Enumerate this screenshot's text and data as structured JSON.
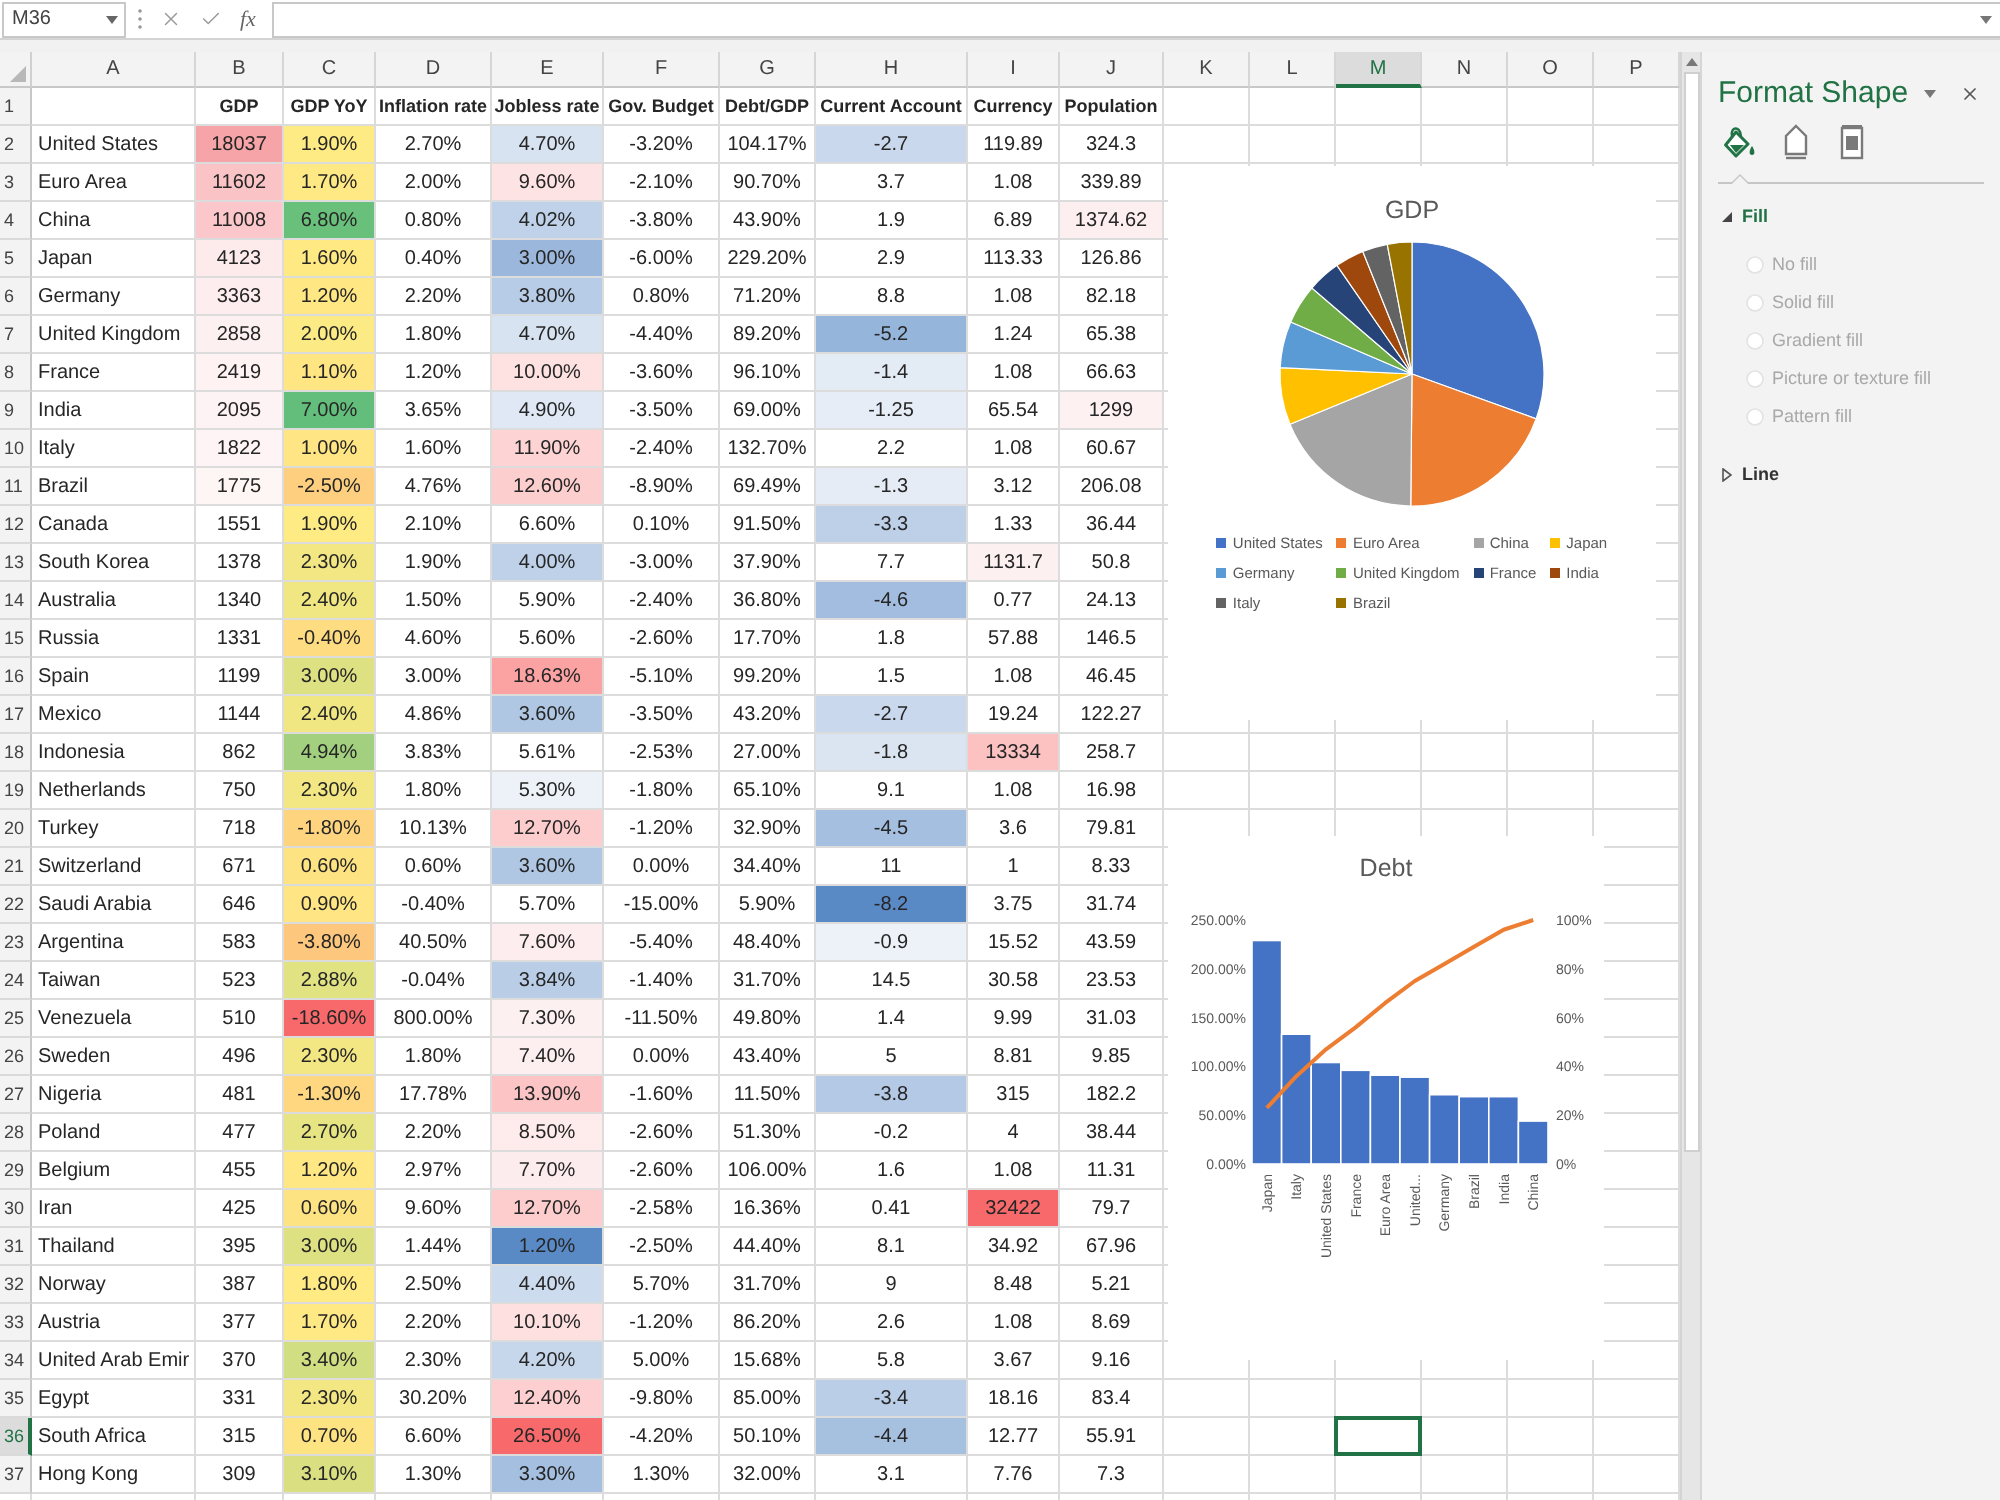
{
  "formula_bar": {
    "name_box": "M36",
    "function_label": "fx"
  },
  "column_headers": [
    {
      "label": "A",
      "selected": false
    },
    {
      "label": "B",
      "selected": false
    },
    {
      "label": "C",
      "selected": false
    },
    {
      "label": "D",
      "selected": false
    },
    {
      "label": "E",
      "selected": false
    },
    {
      "label": "F",
      "selected": false
    },
    {
      "label": "G",
      "selected": false
    },
    {
      "label": "H",
      "selected": false
    },
    {
      "label": "I",
      "selected": false
    },
    {
      "label": "J",
      "selected": false
    },
    {
      "label": "K",
      "selected": false
    },
    {
      "label": "L",
      "selected": false
    },
    {
      "label": "M",
      "selected": true
    },
    {
      "label": "N",
      "selected": false
    },
    {
      "label": "O",
      "selected": false
    },
    {
      "label": "P",
      "selected": false
    }
  ],
  "sheet": {
    "header_row": {
      "number": "1",
      "selected": false,
      "labels": [
        "GDP",
        "GDP YoY",
        "Inflation rate",
        "Jobless rate",
        "Gov. Budget",
        "Debt/GDP",
        "Current Account",
        "Currency",
        "Population"
      ]
    },
    "rows": [
      {
        "number": "2",
        "selected": false,
        "cells": [
          {
            "text": "United States"
          },
          {
            "text": "18037",
            "color": "#f7a4a8"
          },
          {
            "text": "1.90%",
            "color": "#ffeb84"
          },
          {
            "text": "2.70%"
          },
          {
            "text": "4.70%",
            "color": "#d8e3f1"
          },
          {
            "text": "-3.20%"
          },
          {
            "text": "104.17%"
          },
          {
            "text": "-2.7",
            "color": "#c9d8ec"
          },
          {
            "text": "119.89"
          },
          {
            "text": "324.3"
          }
        ]
      },
      {
        "number": "3",
        "selected": false,
        "cells": [
          {
            "text": "Euro Area"
          },
          {
            "text": "11602",
            "color": "#fac4c7"
          },
          {
            "text": "1.70%",
            "color": "#ffe984"
          },
          {
            "text": "2.00%"
          },
          {
            "text": "9.60%",
            "color": "#fee3e4"
          },
          {
            "text": "-2.10%"
          },
          {
            "text": "90.70%"
          },
          {
            "text": "3.7"
          },
          {
            "text": "1.08"
          },
          {
            "text": "339.89"
          }
        ]
      },
      {
        "number": "4",
        "selected": false,
        "cells": [
          {
            "text": "China"
          },
          {
            "text": "11008",
            "color": "#fbc7ca"
          },
          {
            "text": "6.80%",
            "color": "#69c07b"
          },
          {
            "text": "0.80%"
          },
          {
            "text": "4.02%",
            "color": "#bfd2e9"
          },
          {
            "text": "-3.80%"
          },
          {
            "text": "43.90%"
          },
          {
            "text": "1.9"
          },
          {
            "text": "6.89"
          },
          {
            "text": "1374.62",
            "color": "#fdeff0"
          }
        ]
      },
      {
        "number": "5",
        "selected": false,
        "cells": [
          {
            "text": "Japan"
          },
          {
            "text": "4123",
            "color": "#fdeaeb"
          },
          {
            "text": "1.60%",
            "color": "#ffe983"
          },
          {
            "text": "0.40%"
          },
          {
            "text": "3.00%",
            "color": "#9bb8dc"
          },
          {
            "text": "-6.00%"
          },
          {
            "text": "229.20%"
          },
          {
            "text": "2.9"
          },
          {
            "text": "113.33"
          },
          {
            "text": "126.86"
          }
        ]
      },
      {
        "number": "6",
        "selected": false,
        "cells": [
          {
            "text": "Germany"
          },
          {
            "text": "3363",
            "color": "#fdedee"
          },
          {
            "text": "1.20%",
            "color": "#ffe783"
          },
          {
            "text": "2.20%"
          },
          {
            "text": "3.80%",
            "color": "#b7cce6"
          },
          {
            "text": "0.80%"
          },
          {
            "text": "71.20%"
          },
          {
            "text": "8.8"
          },
          {
            "text": "1.08"
          },
          {
            "text": "82.18"
          }
        ]
      },
      {
        "number": "7",
        "selected": false,
        "cells": [
          {
            "text": "United Kingdom"
          },
          {
            "text": "2858",
            "color": "#fdf0f1"
          },
          {
            "text": "2.00%",
            "color": "#fcea84"
          },
          {
            "text": "1.80%"
          },
          {
            "text": "4.70%",
            "color": "#d8e3f1"
          },
          {
            "text": "-4.40%"
          },
          {
            "text": "89.20%"
          },
          {
            "text": "-5.2",
            "color": "#96b5db"
          },
          {
            "text": "1.24"
          },
          {
            "text": "65.38"
          }
        ]
      },
      {
        "number": "8",
        "selected": false,
        "cells": [
          {
            "text": "France"
          },
          {
            "text": "2419",
            "color": "#fef2f3"
          },
          {
            "text": "1.10%",
            "color": "#ffe683"
          },
          {
            "text": "1.20%"
          },
          {
            "text": "10.00%",
            "color": "#fee1e1"
          },
          {
            "text": "-3.60%"
          },
          {
            "text": "96.10%"
          },
          {
            "text": "-1.4",
            "color": "#e3ebf5"
          },
          {
            "text": "1.08"
          },
          {
            "text": "66.63"
          }
        ]
      },
      {
        "number": "9",
        "selected": false,
        "cells": [
          {
            "text": "India"
          },
          {
            "text": "2095",
            "color": "#fef3f4"
          },
          {
            "text": "7.00%",
            "color": "#63be7b"
          },
          {
            "text": "3.65%"
          },
          {
            "text": "4.90%",
            "color": "#dfe8f4"
          },
          {
            "text": "-3.50%"
          },
          {
            "text": "69.00%"
          },
          {
            "text": "-1.25",
            "color": "#e6edf6"
          },
          {
            "text": "65.54"
          },
          {
            "text": "1299",
            "color": "#fdf1f2"
          }
        ]
      },
      {
        "number": "10",
        "selected": false,
        "cells": [
          {
            "text": "Italy"
          },
          {
            "text": "1822",
            "color": "#fef4f5"
          },
          {
            "text": "1.00%",
            "color": "#ffe583"
          },
          {
            "text": "1.60%"
          },
          {
            "text": "11.90%",
            "color": "#fdd3d3"
          },
          {
            "text": "-2.40%"
          },
          {
            "text": "132.70%"
          },
          {
            "text": "2.2"
          },
          {
            "text": "1.08"
          },
          {
            "text": "60.67"
          }
        ]
      },
      {
        "number": "11",
        "selected": false,
        "cells": [
          {
            "text": "Brazil"
          },
          {
            "text": "1775",
            "color": "#fef5f5"
          },
          {
            "text": "-2.50%",
            "color": "#fdcf7f"
          },
          {
            "text": "4.76%"
          },
          {
            "text": "12.60%",
            "color": "#fdcece"
          },
          {
            "text": "-8.90%"
          },
          {
            "text": "69.49%"
          },
          {
            "text": "-1.3",
            "color": "#e5ecf6"
          },
          {
            "text": "3.12"
          },
          {
            "text": "206.08"
          }
        ]
      },
      {
        "number": "12",
        "selected": false,
        "cells": [
          {
            "text": "Canada"
          },
          {
            "text": "1551"
          },
          {
            "text": "1.90%",
            "color": "#ffeb84"
          },
          {
            "text": "2.10%"
          },
          {
            "text": "6.60%"
          },
          {
            "text": "0.10%"
          },
          {
            "text": "91.50%"
          },
          {
            "text": "-3.3",
            "color": "#bdd0e8"
          },
          {
            "text": "1.33"
          },
          {
            "text": "36.44"
          }
        ]
      },
      {
        "number": "13",
        "selected": false,
        "cells": [
          {
            "text": "South Korea"
          },
          {
            "text": "1378"
          },
          {
            "text": "2.30%",
            "color": "#f3e783"
          },
          {
            "text": "1.90%"
          },
          {
            "text": "4.00%",
            "color": "#bed1e9"
          },
          {
            "text": "-3.00%"
          },
          {
            "text": "37.90%"
          },
          {
            "text": "7.7"
          },
          {
            "text": "1131.7",
            "color": "#fdf0f1"
          },
          {
            "text": "50.8"
          }
        ]
      },
      {
        "number": "14",
        "selected": false,
        "cells": [
          {
            "text": "Australia"
          },
          {
            "text": "1340"
          },
          {
            "text": "2.40%",
            "color": "#f0e783"
          },
          {
            "text": "1.50%"
          },
          {
            "text": "5.90%"
          },
          {
            "text": "-2.40%"
          },
          {
            "text": "36.80%"
          },
          {
            "text": "-4.6",
            "color": "#a2bddf"
          },
          {
            "text": "0.77"
          },
          {
            "text": "24.13"
          }
        ]
      },
      {
        "number": "15",
        "selected": false,
        "cells": [
          {
            "text": "Russia"
          },
          {
            "text": "1331"
          },
          {
            "text": "-0.40%",
            "color": "#fedc81"
          },
          {
            "text": "4.60%"
          },
          {
            "text": "5.60%"
          },
          {
            "text": "-2.60%"
          },
          {
            "text": "17.70%"
          },
          {
            "text": "1.8"
          },
          {
            "text": "57.88"
          },
          {
            "text": "146.5"
          }
        ]
      },
      {
        "number": "16",
        "selected": false,
        "cells": [
          {
            "text": "Spain"
          },
          {
            "text": "1199"
          },
          {
            "text": "3.00%",
            "color": "#dde182"
          },
          {
            "text": "3.00%"
          },
          {
            "text": "18.63%",
            "color": "#fba2a3"
          },
          {
            "text": "-5.10%"
          },
          {
            "text": "99.20%"
          },
          {
            "text": "1.5"
          },
          {
            "text": "1.08"
          },
          {
            "text": "46.45"
          }
        ]
      },
      {
        "number": "17",
        "selected": false,
        "cells": [
          {
            "text": "Mexico"
          },
          {
            "text": "1144"
          },
          {
            "text": "2.40%",
            "color": "#f0e783"
          },
          {
            "text": "4.86%"
          },
          {
            "text": "3.60%",
            "color": "#b0c7e4"
          },
          {
            "text": "-3.50%"
          },
          {
            "text": "43.20%"
          },
          {
            "text": "-2.7",
            "color": "#c9d8ec"
          },
          {
            "text": "19.24"
          },
          {
            "text": "122.27"
          }
        ]
      },
      {
        "number": "18",
        "selected": false,
        "cells": [
          {
            "text": "Indonesia"
          },
          {
            "text": "862"
          },
          {
            "text": "4.94%",
            "color": "#a2d07f"
          },
          {
            "text": "3.83%"
          },
          {
            "text": "5.61%"
          },
          {
            "text": "-2.53%"
          },
          {
            "text": "27.00%"
          },
          {
            "text": "-1.8",
            "color": "#dbe5f2"
          },
          {
            "text": "13334",
            "color": "#fcc1c1"
          },
          {
            "text": "258.7"
          }
        ]
      },
      {
        "number": "19",
        "selected": false,
        "cells": [
          {
            "text": "Netherlands"
          },
          {
            "text": "750"
          },
          {
            "text": "2.30%",
            "color": "#f3e783"
          },
          {
            "text": "1.80%"
          },
          {
            "text": "5.30%",
            "color": "#edf2f9"
          },
          {
            "text": "-1.80%"
          },
          {
            "text": "65.10%"
          },
          {
            "text": "9.1"
          },
          {
            "text": "1.08"
          },
          {
            "text": "16.98"
          }
        ]
      },
      {
        "number": "20",
        "selected": false,
        "cells": [
          {
            "text": "Turkey"
          },
          {
            "text": "718"
          },
          {
            "text": "-1.80%",
            "color": "#fed47f"
          },
          {
            "text": "10.13%"
          },
          {
            "text": "12.70%",
            "color": "#fdcdce"
          },
          {
            "text": "-1.20%"
          },
          {
            "text": "32.90%"
          },
          {
            "text": "-4.5",
            "color": "#a4bfe0"
          },
          {
            "text": "3.6"
          },
          {
            "text": "79.81"
          }
        ]
      },
      {
        "number": "21",
        "selected": false,
        "cells": [
          {
            "text": "Switzerland"
          },
          {
            "text": "671"
          },
          {
            "text": "0.60%",
            "color": "#fee383"
          },
          {
            "text": "0.60%"
          },
          {
            "text": "3.60%",
            "color": "#b0c7e4"
          },
          {
            "text": "0.00%"
          },
          {
            "text": "34.40%"
          },
          {
            "text": "11"
          },
          {
            "text": "1"
          },
          {
            "text": "8.33"
          }
        ]
      },
      {
        "number": "22",
        "selected": false,
        "cells": [
          {
            "text": "Saudi Arabia"
          },
          {
            "text": "646"
          },
          {
            "text": "0.90%",
            "color": "#ffe583"
          },
          {
            "text": "-0.40%"
          },
          {
            "text": "5.70%"
          },
          {
            "text": "-15.00%"
          },
          {
            "text": "5.90%"
          },
          {
            "text": "-8.2",
            "color": "#5a8ac6"
          },
          {
            "text": "3.75"
          },
          {
            "text": "31.74"
          }
        ]
      },
      {
        "number": "23",
        "selected": false,
        "cells": [
          {
            "text": "Argentina"
          },
          {
            "text": "583"
          },
          {
            "text": "-3.80%",
            "color": "#fdc77d"
          },
          {
            "text": "40.50%"
          },
          {
            "text": "7.60%",
            "color": "#fdedee"
          },
          {
            "text": "-5.40%"
          },
          {
            "text": "48.40%"
          },
          {
            "text": "-0.9",
            "color": "#edf2f9"
          },
          {
            "text": "15.52"
          },
          {
            "text": "43.59"
          }
        ]
      },
      {
        "number": "24",
        "selected": false,
        "cells": [
          {
            "text": "Taiwan"
          },
          {
            "text": "523"
          },
          {
            "text": "2.88%",
            "color": "#e1e282"
          },
          {
            "text": "-0.04%"
          },
          {
            "text": "3.84%",
            "color": "#b9cde7"
          },
          {
            "text": "-1.40%"
          },
          {
            "text": "31.70%"
          },
          {
            "text": "14.5"
          },
          {
            "text": "30.58"
          },
          {
            "text": "23.53"
          }
        ]
      },
      {
        "number": "25",
        "selected": false,
        "cells": [
          {
            "text": "Venezuela"
          },
          {
            "text": "510"
          },
          {
            "text": "-18.60%",
            "color": "#f8696b"
          },
          {
            "text": "800.00%"
          },
          {
            "text": "7.30%",
            "color": "#fdf0f1"
          },
          {
            "text": "-11.50%"
          },
          {
            "text": "49.80%"
          },
          {
            "text": "1.4"
          },
          {
            "text": "9.99"
          },
          {
            "text": "31.03"
          }
        ]
      },
      {
        "number": "26",
        "selected": false,
        "cells": [
          {
            "text": "Sweden"
          },
          {
            "text": "496"
          },
          {
            "text": "2.30%",
            "color": "#f3e783"
          },
          {
            "text": "1.80%"
          },
          {
            "text": "7.40%",
            "color": "#fdeff0"
          },
          {
            "text": "0.00%"
          },
          {
            "text": "43.40%"
          },
          {
            "text": "5"
          },
          {
            "text": "8.81"
          },
          {
            "text": "9.85"
          }
        ]
      },
      {
        "number": "27",
        "selected": false,
        "cells": [
          {
            "text": "Nigeria"
          },
          {
            "text": "481"
          },
          {
            "text": "-1.30%",
            "color": "#fed780"
          },
          {
            "text": "17.78%"
          },
          {
            "text": "13.90%",
            "color": "#fcc4c5"
          },
          {
            "text": "-1.60%"
          },
          {
            "text": "11.50%"
          },
          {
            "text": "-3.8",
            "color": "#b3c9e5"
          },
          {
            "text": "315"
          },
          {
            "text": "182.2"
          }
        ]
      },
      {
        "number": "28",
        "selected": false,
        "cells": [
          {
            "text": "Poland"
          },
          {
            "text": "477"
          },
          {
            "text": "2.70%",
            "color": "#e7e483"
          },
          {
            "text": "2.20%"
          },
          {
            "text": "8.50%",
            "color": "#feebec"
          },
          {
            "text": "-2.60%"
          },
          {
            "text": "51.30%"
          },
          {
            "text": "-0.2"
          },
          {
            "text": "4"
          },
          {
            "text": "38.44"
          }
        ]
      },
      {
        "number": "29",
        "selected": false,
        "cells": [
          {
            "text": "Belgium"
          },
          {
            "text": "455"
          },
          {
            "text": "1.20%",
            "color": "#ffe783"
          },
          {
            "text": "2.97%"
          },
          {
            "text": "7.70%",
            "color": "#fdecee"
          },
          {
            "text": "-2.60%"
          },
          {
            "text": "106.00%"
          },
          {
            "text": "1.6"
          },
          {
            "text": "1.08"
          },
          {
            "text": "11.31"
          }
        ]
      },
      {
        "number": "30",
        "selected": false,
        "cells": [
          {
            "text": "Iran"
          },
          {
            "text": "425"
          },
          {
            "text": "0.60%",
            "color": "#fee383"
          },
          {
            "text": "9.60%"
          },
          {
            "text": "12.70%",
            "color": "#fdcdce"
          },
          {
            "text": "-2.58%"
          },
          {
            "text": "16.36%"
          },
          {
            "text": "0.41"
          },
          {
            "text": "32422",
            "color": "#f8696b"
          },
          {
            "text": "79.7"
          }
        ]
      },
      {
        "number": "31",
        "selected": false,
        "cells": [
          {
            "text": "Thailand"
          },
          {
            "text": "395"
          },
          {
            "text": "3.00%",
            "color": "#dde182"
          },
          {
            "text": "1.44%"
          },
          {
            "text": "1.20%",
            "color": "#5a8ac6"
          },
          {
            "text": "-2.50%"
          },
          {
            "text": "44.40%"
          },
          {
            "text": "8.1"
          },
          {
            "text": "34.92"
          },
          {
            "text": "67.96"
          }
        ]
      },
      {
        "number": "32",
        "selected": false,
        "cells": [
          {
            "text": "Norway"
          },
          {
            "text": "387"
          },
          {
            "text": "1.80%",
            "color": "#ffea84"
          },
          {
            "text": "2.50%"
          },
          {
            "text": "4.40%",
            "color": "#cddbee"
          },
          {
            "text": "5.70%"
          },
          {
            "text": "31.70%"
          },
          {
            "text": "9"
          },
          {
            "text": "8.48"
          },
          {
            "text": "5.21"
          }
        ]
      },
      {
        "number": "33",
        "selected": false,
        "cells": [
          {
            "text": "Austria"
          },
          {
            "text": "377"
          },
          {
            "text": "1.70%",
            "color": "#ffe984"
          },
          {
            "text": "2.20%"
          },
          {
            "text": "10.10%",
            "color": "#fee0e0"
          },
          {
            "text": "-1.20%"
          },
          {
            "text": "86.20%"
          },
          {
            "text": "2.6"
          },
          {
            "text": "1.08"
          },
          {
            "text": "8.69"
          }
        ]
      },
      {
        "number": "34",
        "selected": false,
        "cells": [
          {
            "text": "United Arab Emir"
          },
          {
            "text": "370"
          },
          {
            "text": "3.40%",
            "color": "#d1de81"
          },
          {
            "text": "2.30%"
          },
          {
            "text": "4.20%",
            "color": "#c6d6eb"
          },
          {
            "text": "5.00%"
          },
          {
            "text": "15.68%"
          },
          {
            "text": "5.8"
          },
          {
            "text": "3.67"
          },
          {
            "text": "9.16"
          }
        ]
      },
      {
        "number": "35",
        "selected": false,
        "cells": [
          {
            "text": "Egypt"
          },
          {
            "text": "331"
          },
          {
            "text": "2.30%",
            "color": "#f3e783"
          },
          {
            "text": "30.20%"
          },
          {
            "text": "12.40%",
            "color": "#fdcfd0"
          },
          {
            "text": "-9.80%"
          },
          {
            "text": "85.00%"
          },
          {
            "text": "-3.4",
            "color": "#bbcee7"
          },
          {
            "text": "18.16"
          },
          {
            "text": "83.4"
          }
        ]
      },
      {
        "number": "36",
        "selected": true,
        "cells": [
          {
            "text": "South Africa"
          },
          {
            "text": "315"
          },
          {
            "text": "0.70%",
            "color": "#fee383"
          },
          {
            "text": "6.60%"
          },
          {
            "text": "26.50%",
            "color": "#f8696b"
          },
          {
            "text": "-4.20%"
          },
          {
            "text": "50.10%"
          },
          {
            "text": "-4.4",
            "color": "#a6c0e0"
          },
          {
            "text": "12.77"
          },
          {
            "text": "55.91"
          }
        ]
      },
      {
        "number": "37",
        "selected": false,
        "cells": [
          {
            "text": "Hong Kong"
          },
          {
            "text": "309"
          },
          {
            "text": "3.10%",
            "color": "#dae082"
          },
          {
            "text": "1.30%"
          },
          {
            "text": "3.30%",
            "color": "#a5bfe0"
          },
          {
            "text": "1.30%"
          },
          {
            "text": "32.00%"
          },
          {
            "text": "3.1"
          },
          {
            "text": "7.76"
          },
          {
            "text": "7.3"
          }
        ]
      }
    ]
  },
  "gdp_chart": {
    "chart_data": [
      {
        "type": "pie",
        "title": "GDP",
        "categories": [
          "United States",
          "Euro Area",
          "China",
          "Japan",
          "Germany",
          "United Kingdom",
          "France",
          "India",
          "Italy",
          "Brazil"
        ],
        "values": [
          30.52,
          19.63,
          18.63,
          6.98,
          5.69,
          4.84,
          4.09,
          3.54,
          3.08,
          3.0
        ],
        "colors": [
          "#4472c4",
          "#ed7d31",
          "#a5a5a5",
          "#ffc000",
          "#5b9bd5",
          "#70ad47",
          "#264478",
          "#9e480e",
          "#636363",
          "#997300"
        ],
        "legend": "bottom"
      }
    ]
  },
  "debt_chart": {
    "chart_data": [
      {
        "type": "bar",
        "title": "Debt",
        "categories": [
          "Japan",
          "Italy",
          "United States",
          "France",
          "Euro Area",
          "United...",
          "Germany",
          "Brazil",
          "India",
          "China"
        ],
        "series": [
          {
            "type": "bar",
            "color": "#4472c4",
            "values": [
              229,
              133,
              104,
              96,
              91,
              89,
              71,
              69,
              69,
              44
            ]
          },
          {
            "type": "line",
            "color": "#ed7d31",
            "axis": "y2",
            "values": [
              23,
              36,
              47,
              56,
              66,
              75,
              82,
              89,
              96,
              100
            ]
          }
        ],
        "ylim": [
          0,
          250
        ],
        "yticks": [
          {
            "value": 0,
            "label": "0.00%"
          },
          {
            "value": 50,
            "label": "50.00%"
          },
          {
            "value": 100,
            "label": "100.00%"
          },
          {
            "value": 150,
            "label": "150.00%"
          },
          {
            "value": 200,
            "label": "200.00%"
          },
          {
            "value": 250,
            "label": "250.00%"
          }
        ],
        "y2lim": [
          0,
          100
        ],
        "y2ticks": [
          {
            "value": 0,
            "label": "0%"
          },
          {
            "value": 20,
            "label": "20%"
          },
          {
            "value": 40,
            "label": "40%"
          },
          {
            "value": 60,
            "label": "60%"
          },
          {
            "value": 80,
            "label": "80%"
          },
          {
            "value": 100,
            "label": "100%"
          }
        ]
      }
    ]
  },
  "format_panel": {
    "title": "Format Shape",
    "tabs": [
      {
        "selected": true
      },
      {
        "selected": false
      },
      {
        "selected": false
      }
    ],
    "sections": [
      {
        "label": "Fill",
        "expanded": true,
        "options": [
          {
            "label": "No fill",
            "selected": false,
            "disabled": true
          },
          {
            "label": "Solid fill",
            "selected": false,
            "disabled": true
          },
          {
            "label": "Gradient fill",
            "selected": false,
            "disabled": true
          },
          {
            "label": "Picture or texture fill",
            "selected": false,
            "disabled": true
          },
          {
            "label": "Pattern fill",
            "selected": false,
            "disabled": true
          }
        ]
      },
      {
        "label": "Line",
        "expanded": false
      }
    ]
  }
}
